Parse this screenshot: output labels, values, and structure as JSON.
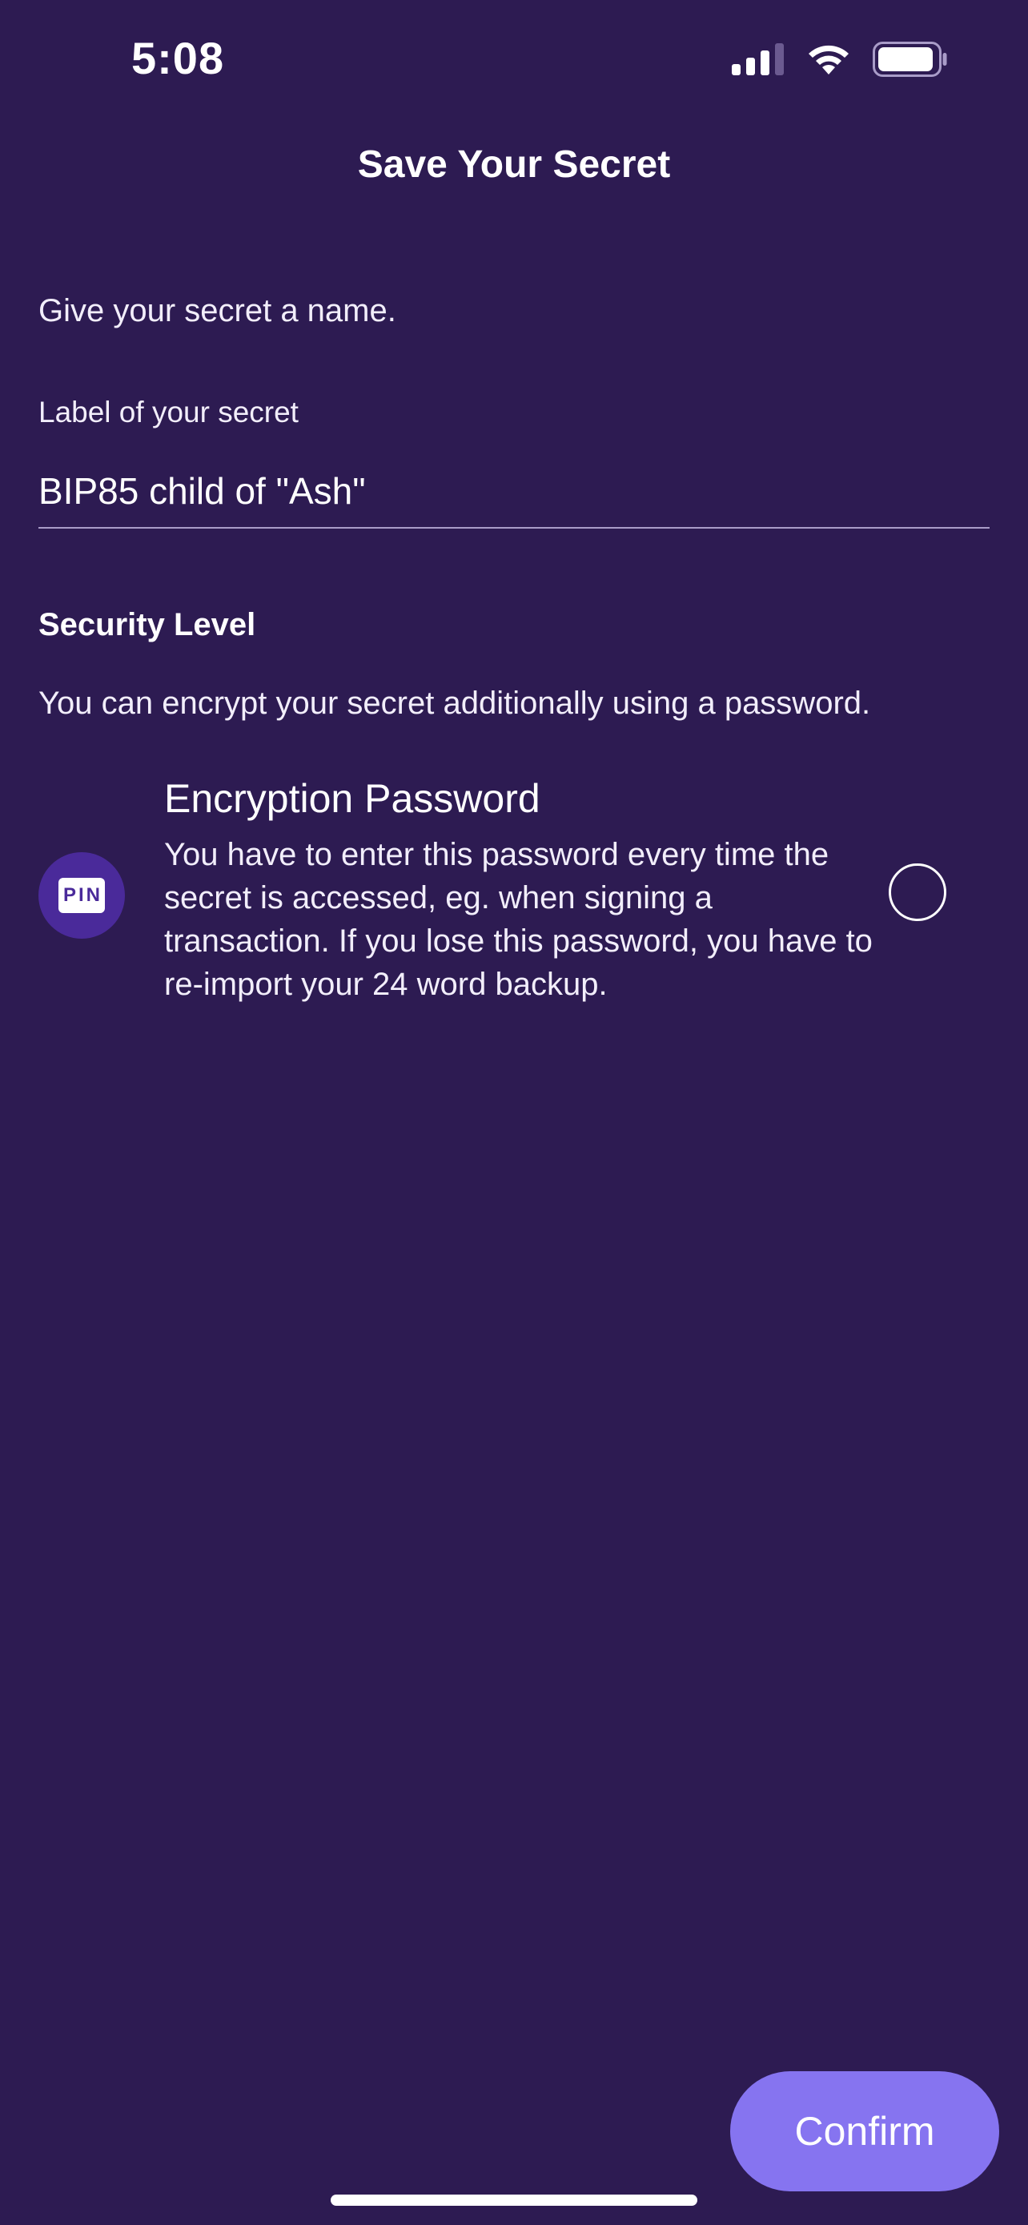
{
  "status_bar": {
    "time": "5:08",
    "icons": [
      "cellular-signal-icon",
      "wifi-icon",
      "battery-icon"
    ]
  },
  "header": {
    "title": "Save Your Secret"
  },
  "name_section": {
    "intro": "Give your secret a name.",
    "field_label": "Label of your secret",
    "field_value": "BIP85 child of \"Ash\""
  },
  "security_section": {
    "title": "Security Level",
    "description": "You can encrypt your secret additionally using a password.",
    "option": {
      "icon": "pin-icon",
      "icon_text": "PIN",
      "title": "Encryption Password",
      "description": "You have to enter this password every time the secret is accessed, eg. when signing a transaction. If you lose this password, you have to re-import your 24 word backup.",
      "selected": false
    }
  },
  "actions": {
    "confirm_label": "Confirm"
  },
  "colors": {
    "background": "#2d1b52",
    "accent": "#8674f0",
    "icon_circle": "#4a2a9a"
  }
}
